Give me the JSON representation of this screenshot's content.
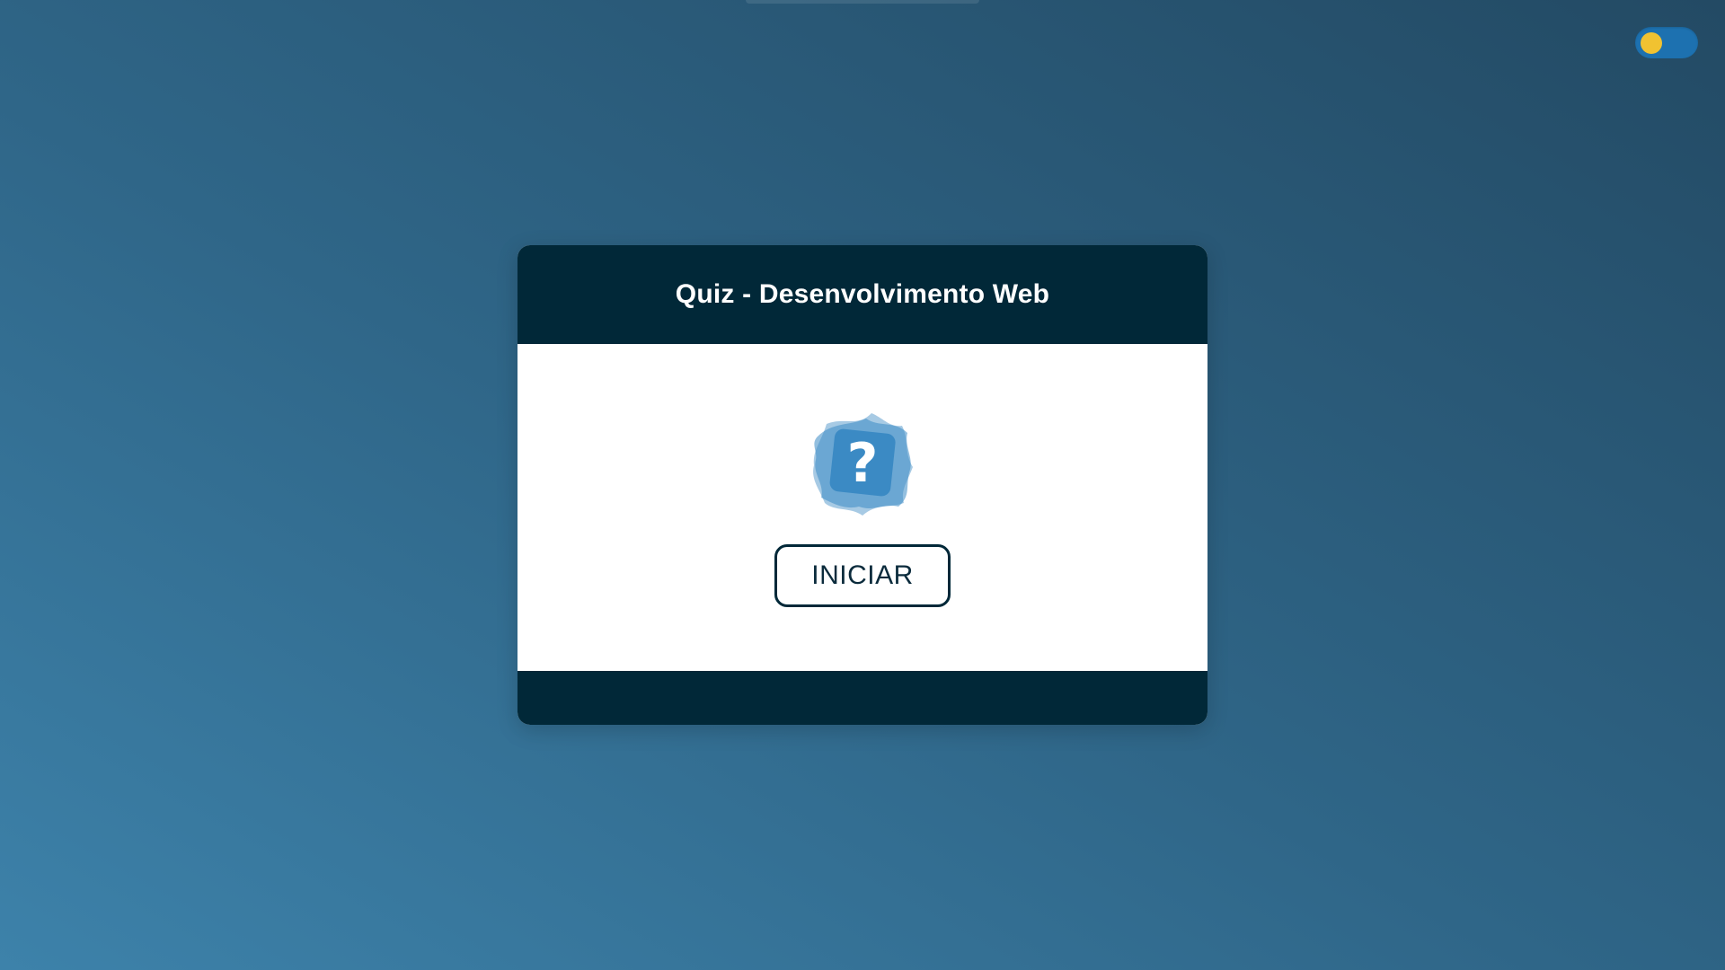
{
  "toggle": {
    "state": "light",
    "track_color": "#1d71b0",
    "knob_color": "#f1c231"
  },
  "quiz": {
    "title": "Quiz - Desenvolvimento Web",
    "icon": "question-mark-icon",
    "start_label": "INICIAR"
  },
  "colors": {
    "card_header": "#012838",
    "card_footer": "#012838",
    "icon_blue": "#3b8ac4",
    "background_light": "#3d82aa",
    "background_dark": "#234a64"
  }
}
